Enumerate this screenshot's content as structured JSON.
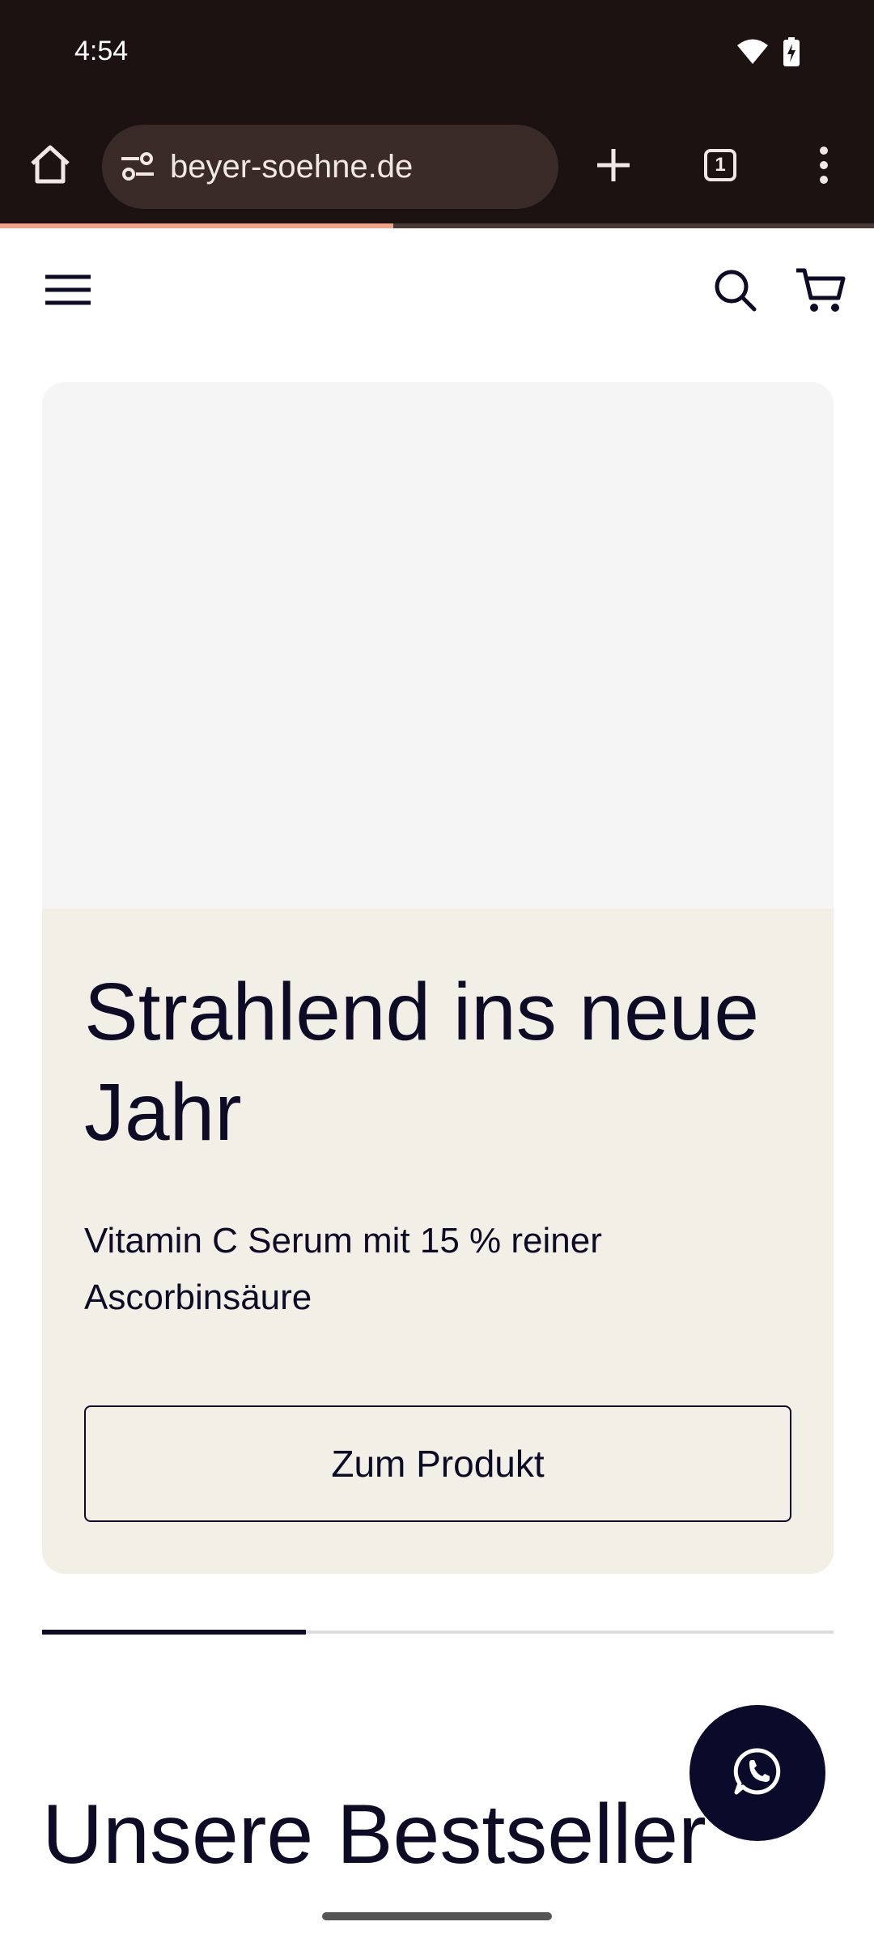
{
  "status_bar": {
    "time": "4:54",
    "wifi_icon": "wifi-icon",
    "battery_icon": "battery-charging-icon"
  },
  "browser": {
    "url": "beyer-soehne.de",
    "tab_count": "1",
    "load_progress": 0.45,
    "icons": [
      "home-icon",
      "site-info-icon",
      "plus-icon",
      "tabs-icon",
      "more-vert-icon"
    ]
  },
  "site_header": {
    "icons": [
      "hamburger-menu-icon",
      "search-icon",
      "cart-icon"
    ]
  },
  "hero": {
    "title": "Strahlend ins neue Jahr",
    "subtitle": "Vitamin C Serum mit 15 % reiner Ascorbinsäure",
    "button_label": "Zum Produkt"
  },
  "slider": {
    "current_slide": 1,
    "total_slides": 3
  },
  "bestsellers": {
    "title": "Unsere Bestseller"
  },
  "colors": {
    "chrome_bg": "#1c1212",
    "url_pill": "#3a2b28",
    "progress": "#f4a287",
    "text_dark": "#0d0b26",
    "hero_panel": "#f2efe6",
    "whatsapp_bg": "#0a0a2a"
  }
}
